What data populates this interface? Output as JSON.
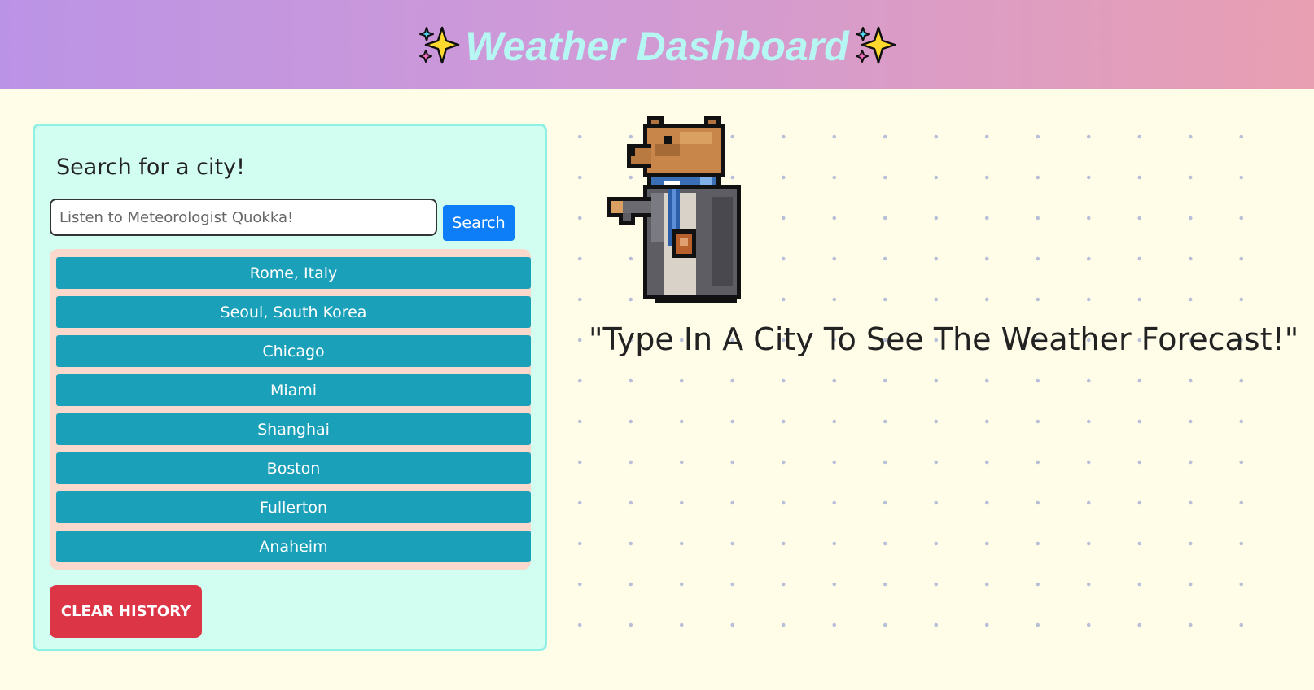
{
  "header": {
    "title": "Weather Dashboard",
    "left_icon": "sparkles-icon",
    "right_icon": "sparkles-icon",
    "background_gradient": [
      "#bb93e6",
      "#e89fb2"
    ],
    "title_color": "#b6f6f3"
  },
  "search_panel": {
    "heading": "Search for a city!",
    "input": {
      "value": "",
      "placeholder": "Listen to Meteorologist Quokka!"
    },
    "search_button": "Search",
    "history": [
      "Rome, Italy",
      "Seoul, South Korea",
      "Chicago",
      "Miami",
      "Shanghai",
      "Boston",
      "Fullerton",
      "Anaheim"
    ],
    "clear_button": "CLEAR HISTORY"
  },
  "main": {
    "mascot_icon": "quokka-meteorologist-icon",
    "quote": "\"Type In A City To See The Weather Forecast!\""
  },
  "colors": {
    "page_background": "#fffde8",
    "panel_background": "#d2fdf1",
    "panel_border": "#8ff0e4",
    "history_background": "#fad8cb",
    "city_button": "#1aa0b9",
    "search_button": "#0d7ef8",
    "clear_button": "#dc3546"
  }
}
